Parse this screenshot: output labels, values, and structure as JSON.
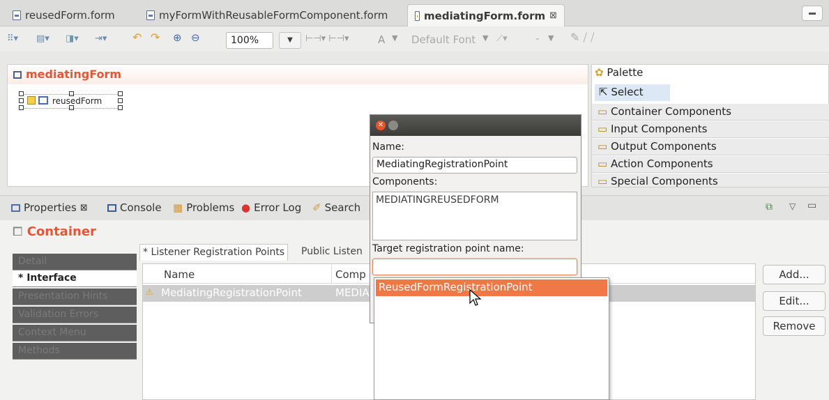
{
  "editor_tabs": [
    {
      "label": "reusedForm.form"
    },
    {
      "label": "myFormWithReusableFormComponent.form"
    },
    {
      "label": "mediatingForm.form",
      "close": "⊠"
    }
  ],
  "toolbar": {
    "zoom": "100%",
    "font_label": "A",
    "font_name": "Default Font",
    "line_style": "-"
  },
  "form_editor": {
    "title": "mediatingForm",
    "component_label": "reusedForm"
  },
  "palette": {
    "title": "Palette",
    "select": "Select",
    "drawers": [
      "Container Components",
      "Input Components",
      "Output Components",
      "Action Components",
      "Special Components"
    ]
  },
  "views": {
    "properties": "Properties",
    "close": "⊠",
    "console": "Console",
    "problems": "Problems",
    "error_log": "Error Log",
    "search": "Search"
  },
  "properties": {
    "title": "Container",
    "side_tabs": [
      "Detail",
      "* Interface",
      "Presentation Hints",
      "Validation Errors",
      "Context Menu",
      "Methods"
    ],
    "sub_tabs": [
      "* Listener Registration Points",
      "Public Listen"
    ],
    "columns": {
      "name": "Name",
      "components": "Comp"
    },
    "row": {
      "name": "MediatingRegistrationPoint",
      "components": "MEDIA"
    },
    "buttons": {
      "add": "Add...",
      "edit": "Edit...",
      "remove": "Remove"
    }
  },
  "dialog": {
    "name_label": "Name:",
    "name_value": "MediatingRegistrationPoint",
    "components_label": "Components:",
    "components_value": "MEDIATINGREUSEDFORM",
    "target_label": "Target registration point name:",
    "target_value": ""
  },
  "popup": {
    "items": [
      "ReusedFormRegistrationPoint"
    ]
  },
  "colors": {
    "accent": "#e2573a",
    "selection": "#f07746",
    "titlebar": "#3c3b37"
  }
}
